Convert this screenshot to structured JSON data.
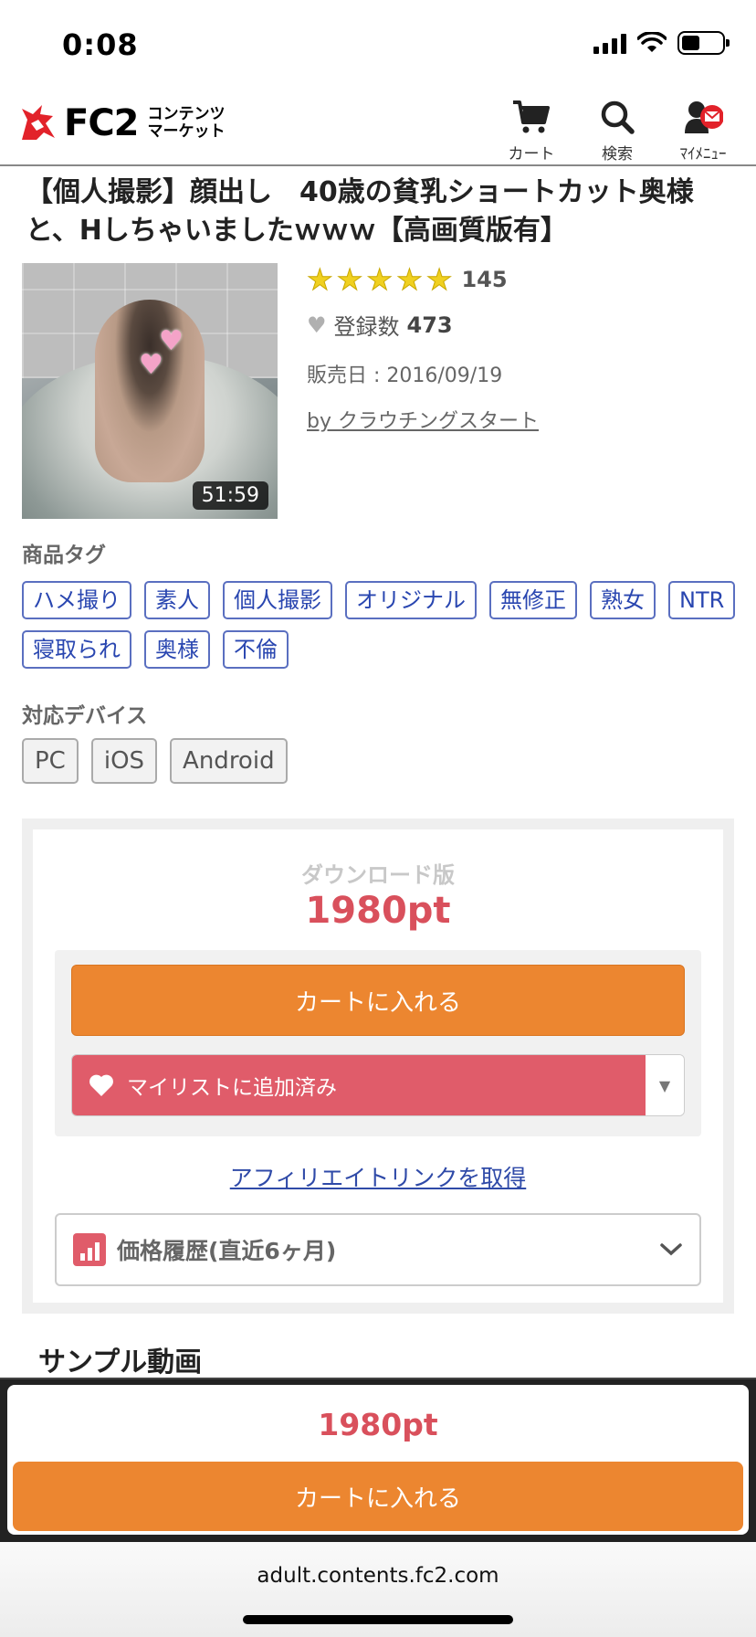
{
  "status_bar": {
    "time": "0:08"
  },
  "header": {
    "logo_text": "FC2",
    "logo_sub_line1": "コンテンツ",
    "logo_sub_line2": "マーケット",
    "nav": [
      {
        "label": "カート",
        "icon": "cart-icon"
      },
      {
        "label": "検索",
        "icon": "search-icon"
      },
      {
        "label": "ﾏｲﾒﾆｭｰ",
        "icon": "user-mail-icon"
      }
    ]
  },
  "product": {
    "title": "【個人撮影】顔出し　40歳の貧乳ショートカット奥様と、Hしちゃいましたｗｗｗ【高画質版有】",
    "duration": "51:59",
    "rating_stars": 5,
    "rating_count": "145",
    "favorites_label": "登録数",
    "favorites_count": "473",
    "release_date": "販売日 : 2016/09/19",
    "seller": "by クラウチングスタート"
  },
  "tags_section": {
    "label": "商品タグ",
    "tags": [
      "ハメ撮り",
      "素人",
      "個人撮影",
      "オリジナル",
      "無修正",
      "熟女",
      "NTR",
      "寝取られ",
      "奥様",
      "不倫"
    ]
  },
  "devices_section": {
    "label": "対応デバイス",
    "devices": [
      "PC",
      "iOS",
      "Android"
    ]
  },
  "purchase": {
    "version_label": "ダウンロード版",
    "price": "1980pt",
    "cart_button": "カートに入れる",
    "mylist_button": "マイリストに追加済み",
    "affiliate_link": "アフィリエイトリンクを取得",
    "price_history": "価格履歴(直近6ヶ月)"
  },
  "sample_heading": "サンプル動画",
  "sticky_bar": {
    "price": "1980pt",
    "cart_button": "カートに入れる"
  },
  "browser": {
    "url": "adult.contents.fc2.com"
  },
  "colors": {
    "accent_orange": "#ec8630",
    "price_red": "#d9505c",
    "tag_blue": "#2946b0",
    "mylist_red": "#e05c6a"
  }
}
